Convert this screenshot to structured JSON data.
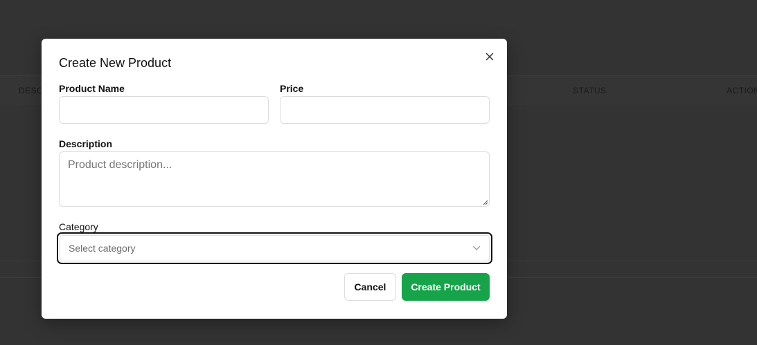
{
  "background_table": {
    "columns": [
      "DESC",
      "STATUS",
      "ACTION"
    ]
  },
  "modal": {
    "title": "Create New Product",
    "close_icon": "close-icon",
    "fields": {
      "product_name": {
        "label": "Product Name",
        "value": "",
        "placeholder": ""
      },
      "price": {
        "label": "Price",
        "value": "",
        "placeholder": ""
      },
      "description": {
        "label": "Description",
        "value": "",
        "placeholder": "Product description..."
      },
      "category": {
        "label": "Category",
        "selected": "Select category",
        "icon": "chevron-down-icon"
      }
    },
    "buttons": {
      "cancel": "Cancel",
      "create": "Create Product"
    }
  },
  "colors": {
    "overlay_background": "#333333",
    "primary_button": "#16a34a",
    "focus_ring": "#111111"
  }
}
